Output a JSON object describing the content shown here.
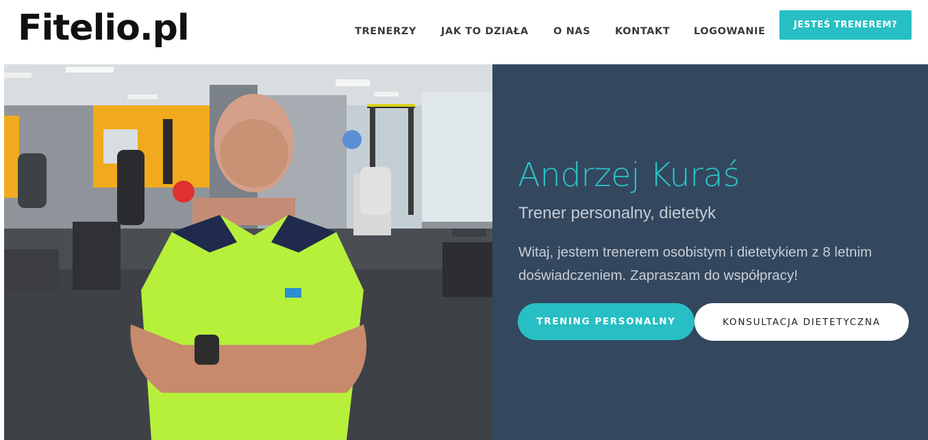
{
  "header": {
    "logo": "Fitelio.pl",
    "nav": [
      "TRENERZY",
      "JAK TO DZIAŁA",
      "O NAS",
      "KONTAKT",
      "LOGOWANIE"
    ],
    "cta_label": "JESTEŚ TRENEREM?"
  },
  "hero": {
    "name": "Andrzej Kuraś",
    "subtitle": "Trener personalny, dietetyk",
    "intro": "Witaj, jestem trenerem osobistym i dietetykiem z 8 letnim doświadczeniem. Zapraszam do współpracy!",
    "primary_button": "TRENING PERSONALNY",
    "secondary_button": "KONSULTACJA DIETETYCZNA"
  },
  "colors": {
    "accent": "#27bfc3",
    "hero_background": "#33475e",
    "name_color": "#2cc2c6",
    "shirt": "#b6f03a"
  }
}
